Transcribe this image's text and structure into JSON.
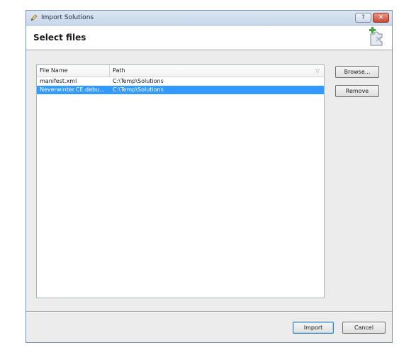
{
  "window": {
    "title": "Import Solutions",
    "help_label": "?",
    "close_label": "✕"
  },
  "header": {
    "title": "Select files"
  },
  "file_list": {
    "columns": [
      "File Name",
      "Path"
    ],
    "sort_indicator": "▽",
    "rows": [
      {
        "name": "manifest.xml",
        "path": "C:\\Temp\\Solutions",
        "selected": false
      },
      {
        "name": "Neverwinter.CE.debu...",
        "path": "C:\\Temp\\Solutions",
        "selected": true
      }
    ]
  },
  "side_buttons": {
    "browse_label": "Browse...",
    "remove_label": "Remove"
  },
  "footer": {
    "import_label": "Import",
    "cancel_label": "Cancel"
  },
  "colors": {
    "selection": "#3399ff",
    "titlebar": "#c9d7ea",
    "close_button": "#c64a33"
  }
}
